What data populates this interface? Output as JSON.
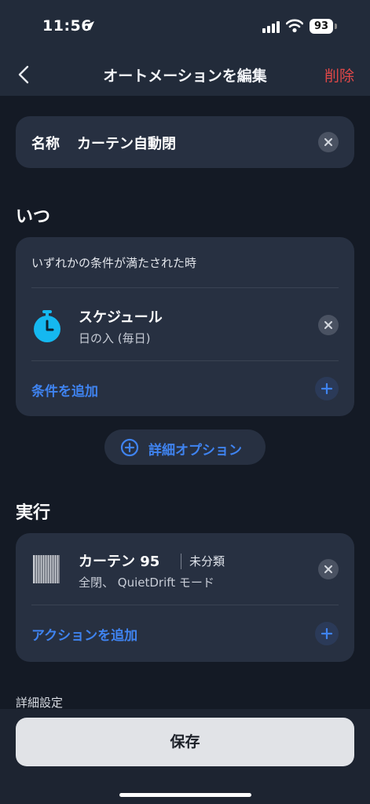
{
  "status_bar": {
    "time": "11:56",
    "battery": "93",
    "icons": [
      "location-arrow-icon",
      "signal-icon",
      "wifi-icon",
      "battery-icon"
    ]
  },
  "nav": {
    "title": "オートメーションを編集",
    "delete_label": "削除",
    "back_icon": "chevron-left-icon"
  },
  "name_field": {
    "label": "名称",
    "value": "カーテン自動閉"
  },
  "when": {
    "title": "いつ",
    "condition_mode": "いずれかの条件が満たされた時",
    "conditions": [
      {
        "title": "スケジュール",
        "subtitle": "日の入 (毎日)",
        "icon": "timer-icon",
        "icon_color": "#15b8f0"
      }
    ],
    "add_condition_label": "条件を追加"
  },
  "advanced_options_label": "詳細オプション",
  "execute": {
    "title": "実行",
    "actions": [
      {
        "device": "カーテン 95",
        "category": "未分類",
        "subtitle": "全閉、 QuietDrift モード",
        "icon": "curtain-icon"
      }
    ],
    "add_action_label": "アクションを追加"
  },
  "advanced_settings_label": "詳細設定",
  "save_label": "保存",
  "colors": {
    "accent": "#3f83f0",
    "danger": "#e04848",
    "background": "#141a25",
    "card": "#273041"
  }
}
